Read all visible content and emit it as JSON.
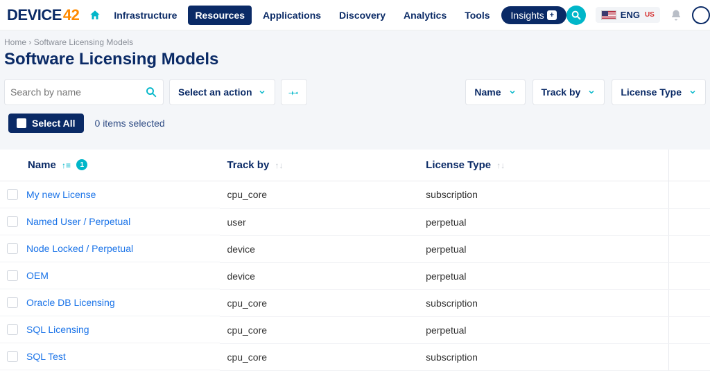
{
  "brand": {
    "name": "DEVICE",
    "suffix": "42"
  },
  "nav": {
    "home_icon": "home-icon",
    "items": [
      {
        "label": "Infrastructure"
      },
      {
        "label": "Resources",
        "active": true
      },
      {
        "label": "Applications"
      },
      {
        "label": "Discovery"
      },
      {
        "label": "Analytics"
      },
      {
        "label": "Tools"
      }
    ],
    "insights_label": "Insights"
  },
  "topright": {
    "lang_code": "ENG",
    "lang_region": "US"
  },
  "breadcrumb": {
    "home": "Home",
    "current": "Software Licensing Models"
  },
  "page_title": "Software Licensing Models",
  "toolbar": {
    "search_placeholder": "Search by name",
    "action_label": "Select an action"
  },
  "filters": [
    {
      "label": "Name"
    },
    {
      "label": "Track by"
    },
    {
      "label": "License Type"
    }
  ],
  "selectbar": {
    "select_all": "Select All",
    "items_selected": "0 items selected"
  },
  "columns": {
    "name": "Name",
    "track_by": "Track by",
    "license_type": "License Type",
    "name_badge": "1"
  },
  "rows": [
    {
      "name": "My new License",
      "track_by": "cpu_core",
      "license_type": "subscription"
    },
    {
      "name": "Named User / Perpetual",
      "track_by": "user",
      "license_type": "perpetual"
    },
    {
      "name": "Node Locked / Perpetual",
      "track_by": "device",
      "license_type": "perpetual"
    },
    {
      "name": "OEM",
      "track_by": "device",
      "license_type": "perpetual"
    },
    {
      "name": "Oracle DB Licensing",
      "track_by": "cpu_core",
      "license_type": "subscription"
    },
    {
      "name": "SQL Licensing",
      "track_by": "cpu_core",
      "license_type": "perpetual"
    },
    {
      "name": "SQL Test",
      "track_by": "cpu_core",
      "license_type": "subscription"
    }
  ]
}
